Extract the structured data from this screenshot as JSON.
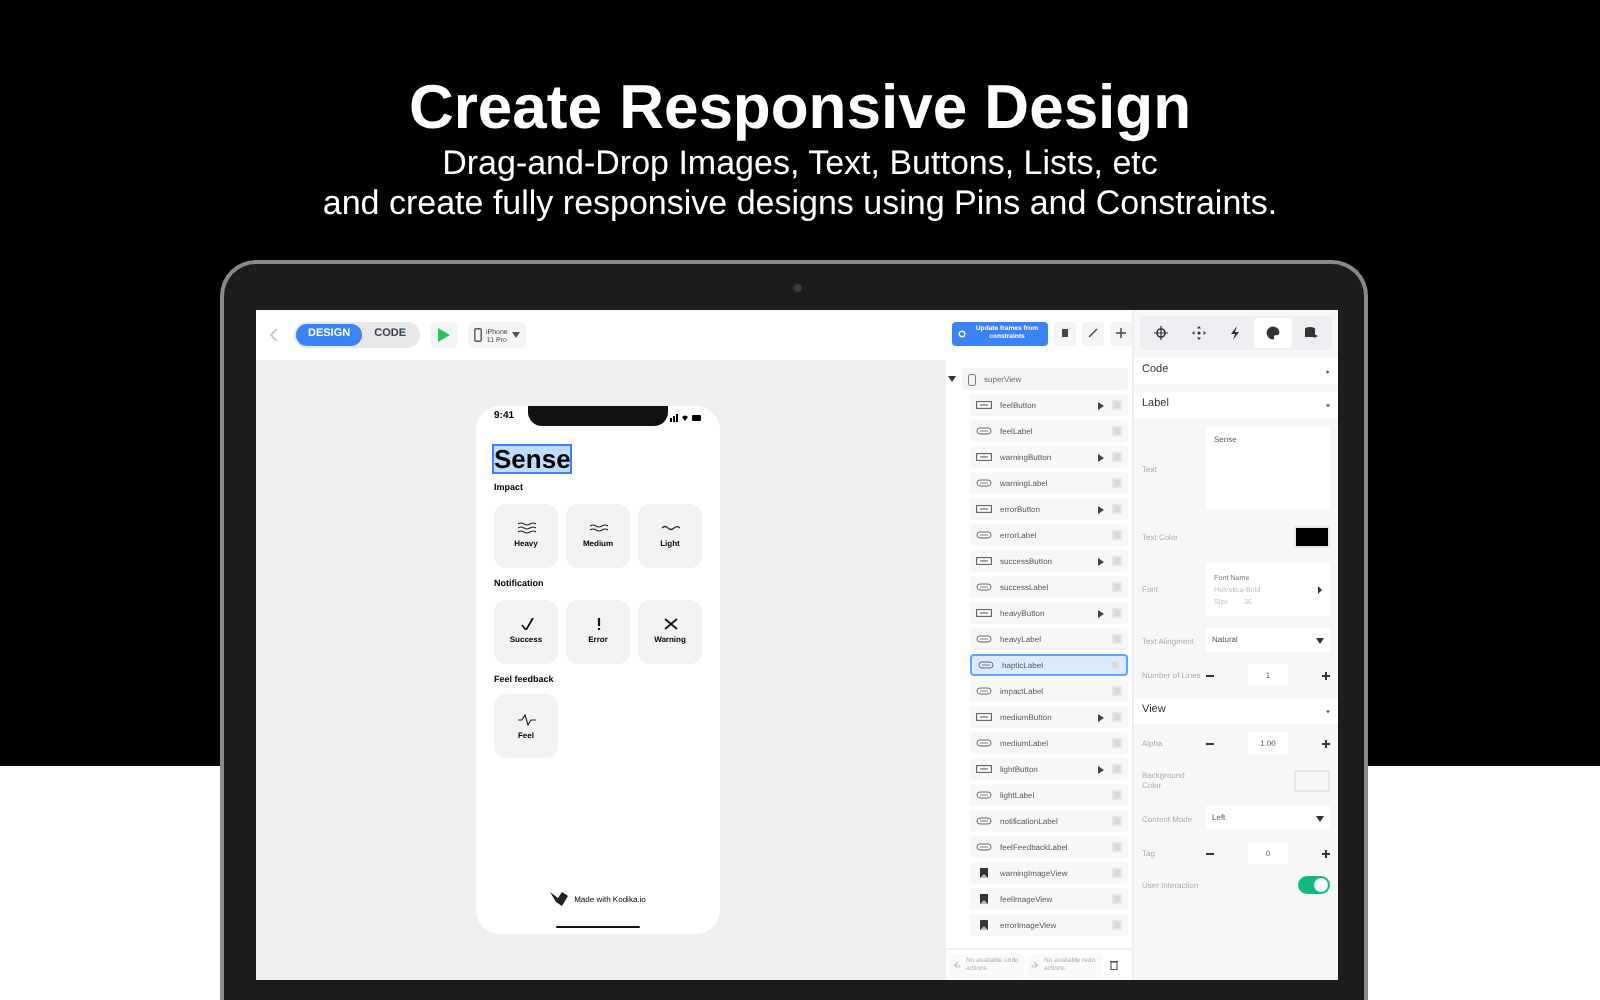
{
  "hero": {
    "title": "Create Responsive Design",
    "subtitle_lines": [
      "Drag-and-Drop Images, Text, Buttons, Lists, etc",
      "and create fully responsive designs using Pins and Constraints."
    ]
  },
  "toolbar": {
    "modes": [
      {
        "label": "DESIGN",
        "selected": true
      },
      {
        "label": "CODE",
        "selected": false
      }
    ],
    "device_lines": [
      "iPhone",
      "11 Pro"
    ]
  },
  "phone": {
    "time": "9:41",
    "title": "Sense",
    "sections": [
      {
        "heading": "Impact",
        "buttons": [
          {
            "label": "Heavy",
            "kind": "heavy"
          },
          {
            "label": "Medium",
            "kind": "medium"
          },
          {
            "label": "Light",
            "kind": "light"
          }
        ]
      },
      {
        "heading": "Notification",
        "buttons": [
          {
            "label": "Success",
            "kind": "success"
          },
          {
            "label": "Error",
            "kind": "error"
          },
          {
            "label": "Warning",
            "kind": "warning"
          }
        ]
      },
      {
        "heading": "Feel feedback",
        "buttons": [
          {
            "label": "Feel",
            "kind": "feel"
          }
        ]
      }
    ],
    "footer": "Made with Kodika.io"
  },
  "outline": {
    "update_button": "Update frames from constraints",
    "root": {
      "label": "superView",
      "expanded": true,
      "children": [
        {
          "label": "feelButton",
          "kind": "button",
          "selected": false
        },
        {
          "label": "feelLabel",
          "kind": "label",
          "selected": false
        },
        {
          "label": "warningButton",
          "kind": "button",
          "selected": false
        },
        {
          "label": "warningLabel",
          "kind": "label",
          "selected": false
        },
        {
          "label": "errorButton",
          "kind": "button",
          "selected": false
        },
        {
          "label": "errorLabel",
          "kind": "label",
          "selected": false
        },
        {
          "label": "successButton",
          "kind": "button",
          "selected": false
        },
        {
          "label": "successLabel",
          "kind": "label",
          "selected": false
        },
        {
          "label": "heavyButton",
          "kind": "button",
          "selected": false
        },
        {
          "label": "heavyLabel",
          "kind": "label",
          "selected": false
        },
        {
          "label": "hapticLabel",
          "kind": "label",
          "selected": true
        },
        {
          "label": "impactLabel",
          "kind": "label",
          "selected": false
        },
        {
          "label": "mediumButton",
          "kind": "button",
          "selected": false
        },
        {
          "label": "mediumLabel",
          "kind": "label",
          "selected": false
        },
        {
          "label": "lightButton",
          "kind": "button",
          "selected": false
        },
        {
          "label": "lightLabel",
          "kind": "label",
          "selected": false
        },
        {
          "label": "notificationLabel",
          "kind": "label",
          "selected": false
        },
        {
          "label": "feelFeedbackLabel",
          "kind": "label",
          "selected": false
        },
        {
          "label": "warningImageView",
          "kind": "image",
          "selected": false
        },
        {
          "label": "feelImageView",
          "kind": "image",
          "selected": false
        },
        {
          "label": "errorImageView",
          "kind": "image",
          "selected": false
        }
      ]
    },
    "undo": "No available undo actions",
    "redo": "No available redo actions"
  },
  "inspector": {
    "tabs": [
      {
        "kind": "constraints",
        "selected": false
      },
      {
        "kind": "move",
        "selected": false
      },
      {
        "kind": "actions",
        "selected": false
      },
      {
        "kind": "style",
        "selected": true
      },
      {
        "kind": "data",
        "selected": false
      }
    ],
    "sections": [
      {
        "title": "Code",
        "expanded": false
      },
      {
        "title": "Label",
        "expanded": true,
        "rows": [
          {
            "kind": "textarea",
            "label": "Text",
            "value": "Sense"
          },
          {
            "kind": "color",
            "label": "Text Color",
            "color": "#000000"
          },
          {
            "kind": "font",
            "label": "Font",
            "heading": "Font Name",
            "name": "Helvetica-Bold",
            "size_label": "Size",
            "size": "36"
          },
          {
            "kind": "select",
            "label": "Text Alingment",
            "value": "Natural"
          },
          {
            "kind": "stepper",
            "label": "Number of Lines",
            "value": "1"
          }
        ]
      },
      {
        "title": "View",
        "expanded": true,
        "rows": [
          {
            "kind": "stepper",
            "label": "Alpha",
            "value": "1.00"
          },
          {
            "kind": "color",
            "label": "Background Color",
            "color": "#f7f7f7"
          },
          {
            "kind": "select",
            "label": "Content Mode",
            "value": "Left"
          },
          {
            "kind": "stepper",
            "label": "Tag",
            "value": "0"
          },
          {
            "kind": "toggle",
            "label": "User Interaction",
            "on": true
          }
        ]
      }
    ]
  }
}
